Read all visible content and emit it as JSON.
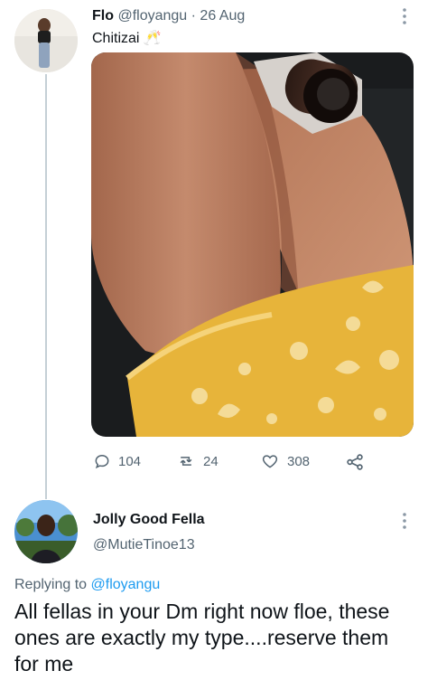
{
  "tweet": {
    "author_name": "Flo",
    "author_handle": "@floyangu",
    "separator": "·",
    "date": "26 Aug",
    "text": "Chitizai",
    "emoji": "🥂",
    "actions": {
      "reply_count": "104",
      "retweet_count": "24",
      "like_count": "308"
    }
  },
  "reply": {
    "author_name": "Jolly Good Fella",
    "author_handle": "@MutieTinoe13",
    "replying_prefix": "Replying to",
    "replying_to": "@floyangu",
    "body": "All fellas in your Dm right now floe, these ones are exactly my type....reserve them for me"
  },
  "colors": {
    "link_blue": "#1d9bf0",
    "muted_text": "#536471",
    "thread_line": "#c4cfd6"
  }
}
